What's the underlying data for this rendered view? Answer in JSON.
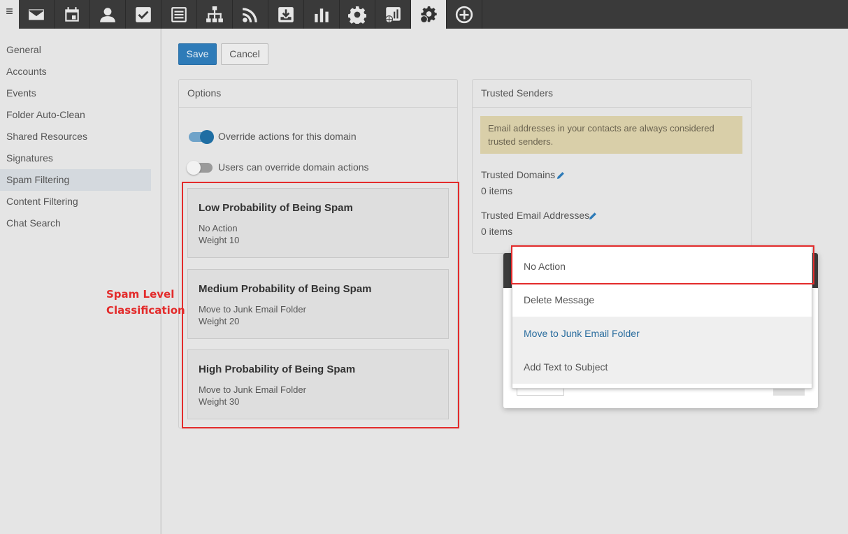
{
  "toolbar": {
    "menu_glyph": "≡",
    "buttons": [
      {
        "name": "mail-icon"
      },
      {
        "name": "calendar-icon"
      },
      {
        "name": "contacts-icon"
      },
      {
        "name": "tasks-icon"
      },
      {
        "name": "notes-icon"
      },
      {
        "name": "sitemap-icon"
      },
      {
        "name": "rss-icon"
      },
      {
        "name": "inbox-download-icon"
      },
      {
        "name": "reports-chart-icon"
      },
      {
        "name": "settings-gear-icon"
      },
      {
        "name": "domain-reports-icon"
      },
      {
        "name": "domain-settings-icon",
        "active": true
      },
      {
        "name": "add-circle-icon"
      }
    ]
  },
  "sidebar": {
    "items": [
      {
        "label": "General"
      },
      {
        "label": "Accounts"
      },
      {
        "label": "Events"
      },
      {
        "label": "Folder Auto-Clean"
      },
      {
        "label": "Shared Resources"
      },
      {
        "label": "Signatures"
      },
      {
        "label": "Spam Filtering",
        "active": true
      },
      {
        "label": "Content Filtering"
      },
      {
        "label": "Chat Search"
      }
    ]
  },
  "actions": {
    "save_label": "Save",
    "cancel_label": "Cancel"
  },
  "options": {
    "title": "Options",
    "toggles": [
      {
        "label": "Override actions for this domain",
        "on": true
      },
      {
        "label": "Users can override domain actions",
        "on": false
      }
    ],
    "spam_levels": [
      {
        "title": "Low Probability of Being Spam",
        "action": "No Action",
        "weight": "Weight 10"
      },
      {
        "title": "Medium Probability of Being Spam",
        "action": "Move to Junk Email Folder",
        "weight": "Weight 20"
      },
      {
        "title": "High Probability of Being Spam",
        "action": "Move to Junk Email Folder",
        "weight": "Weight 30"
      }
    ]
  },
  "trusted": {
    "title": "Trusted Senders",
    "note": "Email addresses in your contacts are always considered trusted senders.",
    "domains_label": "Trusted Domains",
    "domains_count": "0 items",
    "emails_label": "Trusted Email Addresses",
    "emails_count": "0 items"
  },
  "annotation": {
    "line1": "Spam Level",
    "line2": "Classification",
    "color": "#e32b2b"
  },
  "dropdown": {
    "options": [
      {
        "label": "No Action"
      },
      {
        "label": "Delete Message"
      },
      {
        "label": "Move to Junk Email Folder",
        "selected": true
      },
      {
        "label": "Add Text to Subject"
      }
    ]
  },
  "colors": {
    "accent": "#2e7bb8",
    "toolbar": "#3a3a3a",
    "highlight": "#e32b2b"
  }
}
